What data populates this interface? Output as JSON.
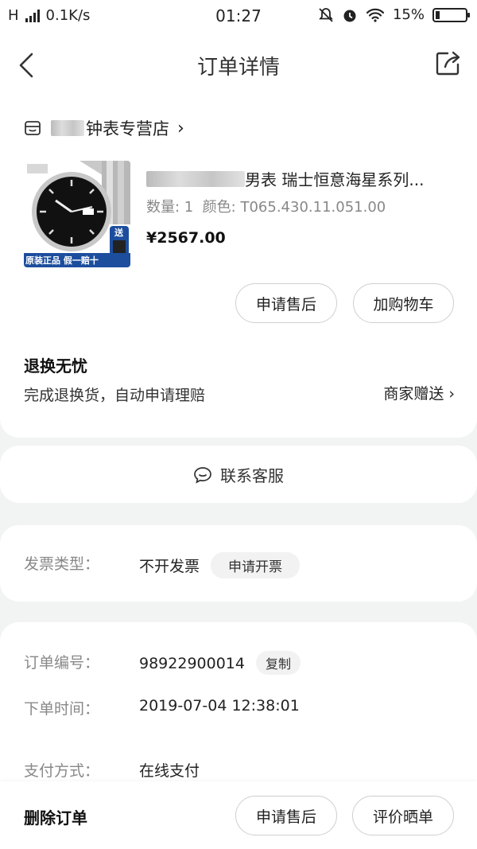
{
  "status_bar": {
    "network": "H",
    "speed": "0.1K/s",
    "time": "01:27",
    "battery": "15%",
    "battery_level": 0.15
  },
  "nav": {
    "title": "订单详情"
  },
  "store": {
    "name_suffix": "钟表专营店",
    "arrow": "›"
  },
  "product": {
    "title_visible": "男表 瑞士恒意海星系列...",
    "spec": "数量: 1  颜色: T065.430.11.051.00",
    "price": "¥2567.00",
    "image_badge": "原装正品 假一赔十",
    "image_tag": "送"
  },
  "actions": {
    "after_sale": "申请售后",
    "add_cart": "加购物车"
  },
  "guarantee": {
    "title": "退换无忧",
    "desc": "完成退换货，自动申请理赔",
    "tag": "商家赠送 ›"
  },
  "service": {
    "label": "联系客服"
  },
  "invoice": {
    "label": "发票类型：",
    "value": "不开发票",
    "button": "申请开票"
  },
  "order": {
    "no_label": "订单编号：",
    "no_value": "98922900014",
    "copy": "复制",
    "time_label": "下单时间：",
    "time_value": "2019-07-04 12:38:01",
    "pay_label": "支付方式：",
    "pay_value": "在线支付"
  },
  "bottom_bar": {
    "delete": "删除订单",
    "after_sale": "申请售后",
    "review": "评价晒单"
  }
}
